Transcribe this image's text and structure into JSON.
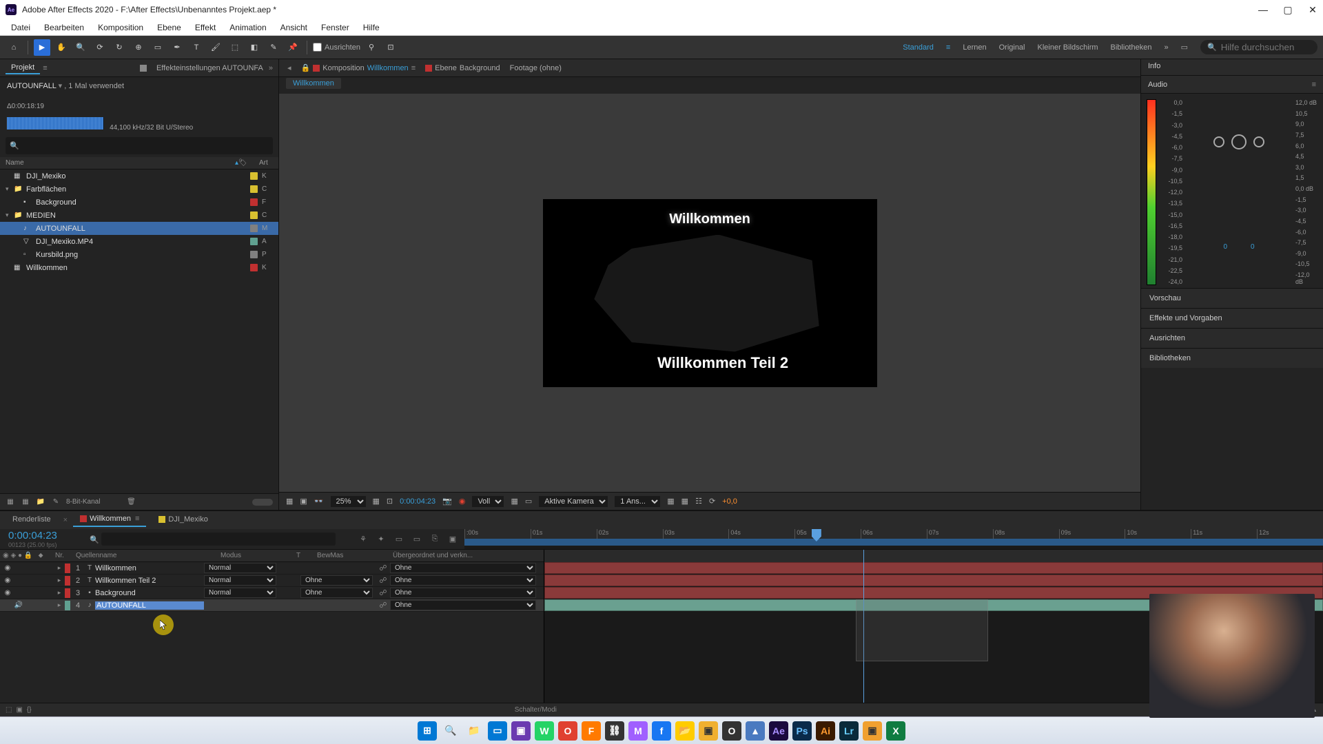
{
  "titlebar": {
    "icon_text": "Ae",
    "title": "Adobe After Effects 2020 - F:\\After Effects\\Unbenanntes Projekt.aep *"
  },
  "menu": [
    "Datei",
    "Bearbeiten",
    "Komposition",
    "Ebene",
    "Effekt",
    "Animation",
    "Ansicht",
    "Fenster",
    "Hilfe"
  ],
  "toolbar": {
    "align_label": "Ausrichten",
    "workspaces": {
      "active": "Standard",
      "items": [
        "Lernen",
        "Original",
        "Kleiner Bildschirm",
        "Bibliotheken"
      ]
    },
    "search_placeholder": "Hilfe durchsuchen"
  },
  "left_tabs": {
    "project": "Projekt",
    "effect_settings_prefix": "Effekteinstellungen",
    "effect_settings_target": "AUTOUNFA"
  },
  "project_info": {
    "name": "AUTOUNFALL",
    "usage": ", 1 Mal verwendet",
    "duration": "Δ0:00:18:19",
    "audio_spec": "44,100 kHz/32 Bit U/Stereo"
  },
  "project_cols": {
    "name": "Name",
    "tag": "",
    "type": "Art"
  },
  "project_tree": [
    {
      "indent": 0,
      "twisty": "",
      "icon": "▦",
      "name": "DJI_Mexiko",
      "tag": "#d8c030",
      "type": "K",
      "selected": false
    },
    {
      "indent": 0,
      "twisty": "▾",
      "icon": "📁",
      "name": "Farbflächen",
      "tag": "#d8c030",
      "type": "C",
      "selected": false
    },
    {
      "indent": 1,
      "twisty": "",
      "icon": "▪",
      "name": "Background",
      "tag": "#c03030",
      "type": "F",
      "selected": false
    },
    {
      "indent": 0,
      "twisty": "▾",
      "icon": "📁",
      "name": "MEDIEN",
      "tag": "#d8c030",
      "type": "C",
      "selected": false
    },
    {
      "indent": 1,
      "twisty": "",
      "icon": "♪",
      "name": "AUTOUNFALL",
      "tag": "#808080",
      "type": "M",
      "selected": true
    },
    {
      "indent": 1,
      "twisty": "",
      "icon": "▽",
      "name": "DJI_Mexiko.MP4",
      "tag": "#60a090",
      "type": "A",
      "selected": false
    },
    {
      "indent": 1,
      "twisty": "",
      "icon": "▫",
      "name": "Kursbild.png",
      "tag": "#808080",
      "type": "P",
      "selected": false
    },
    {
      "indent": 0,
      "twisty": "",
      "icon": "▦",
      "name": "Willkommen",
      "tag": "#c03030",
      "type": "K",
      "selected": false
    }
  ],
  "project_footer": {
    "depth": "8-Bit-Kanal"
  },
  "viewer_tabs": {
    "comp_prefix": "Komposition",
    "comp_name": "Willkommen",
    "layer_prefix": "Ebene",
    "layer_name": "Background",
    "footage": "Footage (ohne)"
  },
  "comp_nav": {
    "crumb": "Willkommen"
  },
  "preview": {
    "text1": "Willkommen",
    "text2": "Willkommen Teil 2"
  },
  "viewer_controls": {
    "zoom": "25%",
    "timecode": "0:00:04:23",
    "res": "Voll",
    "camera": "Aktive Kamera",
    "views": "1 Ans...",
    "exposure": "+0,0"
  },
  "right": {
    "info": "Info",
    "audio": "Audio",
    "left_scale": [
      "0,0",
      "-1,5",
      "-3,0",
      "-4,5",
      "-6,0",
      "-7,5",
      "-9,0",
      "-10,5",
      "-12,0",
      "-13,5",
      "-15,0",
      "-16,5",
      "-18,0",
      "-19,5",
      "-21,0",
      "-22,5",
      "-24,0"
    ],
    "right_scale": [
      "12,0 dB",
      "10,5",
      "9,0",
      "7,5",
      "6,0",
      "4,5",
      "3,0",
      "1,5",
      "0,0 dB",
      "-1,5",
      "-3,0",
      "-4,5",
      "-6,0",
      "-7,5",
      "-9,0",
      "-10,5",
      "-12,0 dB"
    ],
    "knob_vals": [
      "0",
      "0"
    ],
    "sections": [
      "Vorschau",
      "Effekte und Vorgaben",
      "Ausrichten",
      "Bibliotheken"
    ]
  },
  "timeline": {
    "tabs": {
      "render": "Renderliste",
      "active": "Willkommen",
      "other": "DJI_Mexiko"
    },
    "timecode": "0:00:04:23",
    "frames": "00123 (25.00 fps)",
    "cols": {
      "nr": "Nr.",
      "name": "Quellenname",
      "mode": "Modus",
      "t": "T",
      "bewmas": "BewMas",
      "parent": "Übergeordnet und verkn..."
    },
    "ruler": [
      ":00s",
      "01s",
      "02s",
      "03s",
      "04s",
      "05s",
      "06s",
      "07s",
      "08s",
      "09s",
      "10s",
      "11s",
      "12s"
    ],
    "layers": [
      {
        "eye": true,
        "speaker": false,
        "color": "#c03030",
        "nr": "1",
        "icon": "T",
        "name": "Willkommen",
        "mode": "Normal",
        "bewmas": "",
        "parent": "Ohne",
        "bar": {
          "start": 0,
          "end": 100,
          "color": "#8a3a3a"
        },
        "selected": false
      },
      {
        "eye": true,
        "speaker": false,
        "color": "#c03030",
        "nr": "2",
        "icon": "T",
        "name": "Willkommen Teil 2",
        "mode": "Normal",
        "bewmas": "Ohne",
        "parent": "Ohne",
        "bar": {
          "start": 0,
          "end": 100,
          "color": "#8a3a3a"
        },
        "selected": false
      },
      {
        "eye": true,
        "speaker": false,
        "color": "#c03030",
        "nr": "3",
        "icon": "▪",
        "name": "Background",
        "mode": "Normal",
        "bewmas": "Ohne",
        "parent": "Ohne",
        "bar": {
          "start": 0,
          "end": 100,
          "color": "#8a3a3a"
        },
        "selected": false
      },
      {
        "eye": false,
        "speaker": true,
        "color": "#60a090",
        "nr": "4",
        "icon": "♪",
        "name": "AUTOUNFALL",
        "mode": "",
        "bewmas": "",
        "parent": "Ohne",
        "bar": {
          "start": 0,
          "end": 100,
          "color": "#6aa090"
        },
        "selected": true
      }
    ],
    "footer": {
      "switch": "Schalter/Modi"
    },
    "playhead_pct": 41,
    "zoom": {
      "start": 40,
      "end": 57
    }
  },
  "taskbar": [
    {
      "bg": "#0078d4",
      "fg": "#fff",
      "text": "⊞"
    },
    {
      "bg": "transparent",
      "fg": "#333",
      "text": "🔍"
    },
    {
      "bg": "transparent",
      "fg": "#333",
      "text": "📁"
    },
    {
      "bg": "#0078d4",
      "fg": "#fff",
      "text": "▭"
    },
    {
      "bg": "#6a3ab0",
      "fg": "#fff",
      "text": "▣"
    },
    {
      "bg": "#25d366",
      "fg": "#fff",
      "text": "W"
    },
    {
      "bg": "#e04030",
      "fg": "#fff",
      "text": "O"
    },
    {
      "bg": "#ff7a00",
      "fg": "#fff",
      "text": "F"
    },
    {
      "bg": "#333",
      "fg": "#fff",
      "text": "⛓"
    },
    {
      "bg": "#a060ff",
      "fg": "#fff",
      "text": "M"
    },
    {
      "bg": "#1877f2",
      "fg": "#fff",
      "text": "f"
    },
    {
      "bg": "#ffcc00",
      "fg": "#333",
      "text": "📂"
    },
    {
      "bg": "#f0b030",
      "fg": "#333",
      "text": "▣"
    },
    {
      "bg": "#333",
      "fg": "#fff",
      "text": "O"
    },
    {
      "bg": "#4a7ac0",
      "fg": "#fff",
      "text": "▲"
    },
    {
      "bg": "#1a0a3e",
      "fg": "#a98fff",
      "text": "Ae"
    },
    {
      "bg": "#0a2a4a",
      "fg": "#6ac0ff",
      "text": "Ps"
    },
    {
      "bg": "#3a1a00",
      "fg": "#ff9a30",
      "text": "Ai"
    },
    {
      "bg": "#0a2a3a",
      "fg": "#6ad0ff",
      "text": "Lr"
    },
    {
      "bg": "#f0a030",
      "fg": "#333",
      "text": "▣"
    },
    {
      "bg": "#107c41",
      "fg": "#fff",
      "text": "X"
    }
  ]
}
